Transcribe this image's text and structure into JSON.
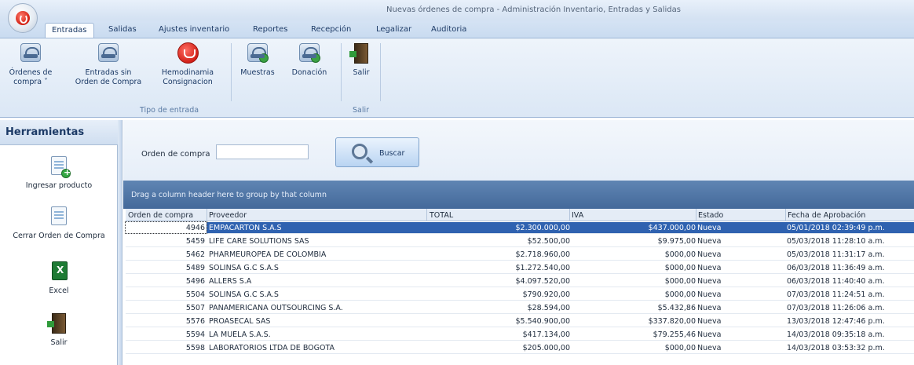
{
  "window": {
    "title": "Nuevas órdenes de compra - Administración Inventario, Entradas y Salidas"
  },
  "ribbon_tabs": [
    "Entradas",
    "Salidas",
    "Ajustes inventario",
    "Reportes",
    "Recepción",
    "Legalizar",
    "Auditoria"
  ],
  "ribbon": {
    "ordenes_compra": [
      "Órdenes de",
      "compra ˅"
    ],
    "entradas_sin_oc": [
      "Entradas sin",
      "Orden de Compra"
    ],
    "hemodinamia": [
      "Hemodinamia",
      "Consignacion"
    ],
    "muestras": "Muestras",
    "donacion": "Donación",
    "salir": "Salir",
    "group_tipo_entrada": "Tipo de entrada",
    "group_salir": "Salir"
  },
  "herramientas": {
    "title": "Herramientas",
    "items": [
      "Ingresar producto",
      "Cerrar Orden de Compra",
      "Excel",
      "Salir"
    ],
    "excel_badge": "XLS"
  },
  "search": {
    "label": "Orden de compra",
    "value": "",
    "button_label": "Buscar"
  },
  "grid": {
    "group_hint": "Drag a column header here to group by that column",
    "columns": [
      "Orden de compra",
      "Proveedor",
      "TOTAL",
      "IVA",
      "Estado",
      "Fecha de Aprobación"
    ],
    "rows": [
      {
        "orden": "4946",
        "proveedor": "EMPACARTON S.A.S",
        "total": "$2.300.000,00",
        "iva": "$437.000,00",
        "estado": "Nueva",
        "fecha": "05/01/2018 02:39:49 p.m."
      },
      {
        "orden": "5459",
        "proveedor": "LIFE CARE SOLUTIONS SAS",
        "total": "$52.500,00",
        "iva": "$9.975,00",
        "estado": "Nueva",
        "fecha": "05/03/2018 11:28:10 a.m."
      },
      {
        "orden": "5462",
        "proveedor": "PHARMEUROPEA DE COLOMBIA",
        "total": "$2.718.960,00",
        "iva": "$000,00",
        "estado": "Nueva",
        "fecha": "05/03/2018 11:31:17 a.m."
      },
      {
        "orden": "5489",
        "proveedor": "SOLINSA G.C S.A.S",
        "total": "$1.272.540,00",
        "iva": "$000,00",
        "estado": "Nueva",
        "fecha": "06/03/2018 11:36:49 a.m."
      },
      {
        "orden": "5496",
        "proveedor": "ALLERS S.A",
        "total": "$4.097.520,00",
        "iva": "$000,00",
        "estado": "Nueva",
        "fecha": "06/03/2018 11:40:40 a.m."
      },
      {
        "orden": "5504",
        "proveedor": "SOLINSA G.C S.A.S",
        "total": "$790.920,00",
        "iva": "$000,00",
        "estado": "Nueva",
        "fecha": "07/03/2018 11:24:51 a.m."
      },
      {
        "orden": "5507",
        "proveedor": "PANAMERICANA OUTSOURCING S.A.",
        "total": "$28.594,00",
        "iva": "$5.432,86",
        "estado": "Nueva",
        "fecha": "07/03/2018 11:26:06 a.m."
      },
      {
        "orden": "5576",
        "proveedor": "PROASECAL SAS",
        "total": "$5.540.900,00",
        "iva": "$337.820,00",
        "estado": "Nueva",
        "fecha": "13/03/2018 12:47:46 p.m."
      },
      {
        "orden": "5594",
        "proveedor": "LA MUELA S.A.S.",
        "total": "$417.134,00",
        "iva": "$79.255,46",
        "estado": "Nueva",
        "fecha": "14/03/2018 09:35:18 a.m."
      },
      {
        "orden": "5598",
        "proveedor": "LABORATORIOS LTDA DE BOGOTA",
        "total": "$205.000,00",
        "iva": "$000,00",
        "estado": "Nueva",
        "fecha": "14/03/2018 03:53:32 p.m."
      }
    ]
  }
}
